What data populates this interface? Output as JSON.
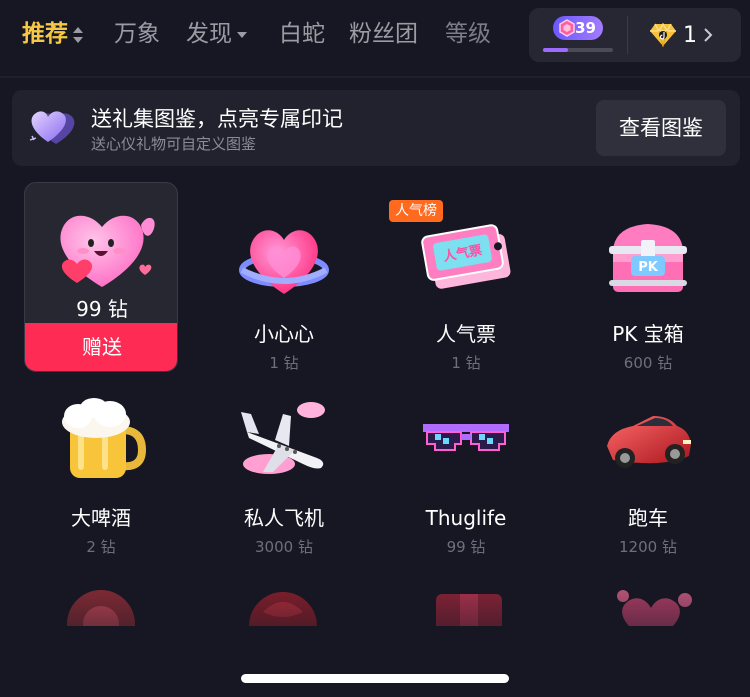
{
  "tabs": [
    {
      "label": "推荐",
      "active": true
    },
    {
      "label": "万象"
    },
    {
      "label": "发现"
    },
    {
      "label": "白蛇"
    },
    {
      "label": "粉丝团"
    },
    {
      "label": "等级"
    }
  ],
  "wallet": {
    "level": "39",
    "level_progress": 0.35,
    "diamonds": "1"
  },
  "banner": {
    "title": "送礼集图鉴，点亮专属印记",
    "subtitle": "送心仪礼物可自定义图鉴",
    "button": "查看图鉴"
  },
  "gifts": [
    {
      "name": "",
      "price": "99 钻",
      "selected": true,
      "send_label": "赠送",
      "icon": "pink-heart-mascot-icon"
    },
    {
      "name": "小心心",
      "price": "1 钻",
      "icon": "small-heart-icon"
    },
    {
      "name": "人气票",
      "price": "1 钻",
      "tag": "人气榜",
      "icon": "popularity-ticket-icon"
    },
    {
      "name": "PK 宝箱",
      "price": "600 钻",
      "icon": "pk-chest-icon"
    },
    {
      "name": "大啤酒",
      "price": "2 钻",
      "icon": "beer-mug-icon"
    },
    {
      "name": "私人飞机",
      "price": "3000 钻",
      "icon": "private-jet-icon"
    },
    {
      "name": "Thuglife",
      "price": "99 钻",
      "icon": "pixel-sunglasses-icon"
    },
    {
      "name": "跑车",
      "price": "1200 钻",
      "icon": "sports-car-icon"
    }
  ],
  "colors": {
    "accent_gold": "#f6c844",
    "send_red": "#fe2c55",
    "tag_orange": "#ff6a1f",
    "background": "#161722"
  }
}
